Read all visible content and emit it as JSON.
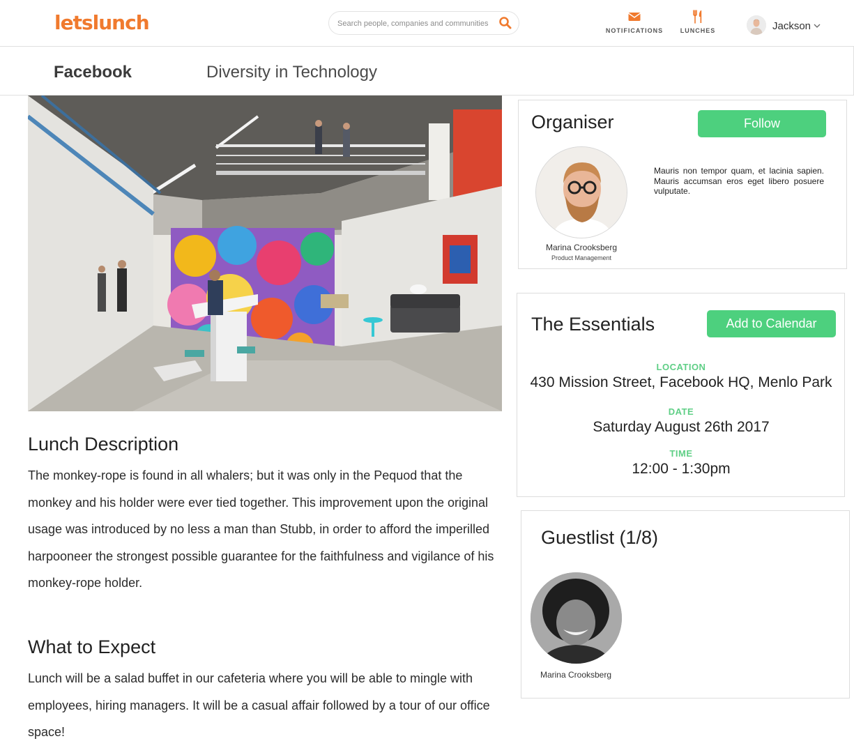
{
  "header": {
    "logo": "letslunch",
    "search_placeholder": "Search people, companies and communities",
    "nav": {
      "notifications_label": "NOTIFICATIONS",
      "lunches_label": "LUNCHES"
    },
    "user_name": "Jackson"
  },
  "subheader": {
    "company": "Facebook",
    "event_title": "Diversity in Technology"
  },
  "description": {
    "title": "Lunch Description",
    "body": "The monkey-rope is found in all whalers; but it was only in the Pequod that the monkey and his holder were ever tied together. This improvement upon the original usage was introduced by no less a man than Stubb, in order to afford the imperilled harpooneer the strongest possible guarantee for the faithfulness and vigilance of his monkey-rope holder."
  },
  "expect": {
    "title": "What to Expect",
    "body": "Lunch will be a salad buffet in our cafeteria where you will be able to mingle with employees, hiring managers. It will be a casual affair followed by a tour of our office space!"
  },
  "organiser": {
    "title": "Organiser",
    "follow_label": "Follow",
    "name": "Marina Crooksberg",
    "role": "Product Management",
    "bio": "Mauris non tempor quam, et lacinia sapien. Mauris accumsan eros eget libero posuere vulputate."
  },
  "essentials": {
    "title": "The Essentials",
    "calendar_label": "Add to Calendar",
    "location_label": "LOCATION",
    "location": "430 Mission Street, Facebook HQ, Menlo Park",
    "date_label": "DATE",
    "date": "Saturday August 26th 2017",
    "time_label": "TIME",
    "time": "12:00 - 1:30pm"
  },
  "guestlist": {
    "title": "Guestlist (1/8)",
    "guests": [
      {
        "name": "Marina Crooksberg"
      }
    ]
  },
  "colors": {
    "brand_orange": "#f07a2e",
    "accent_green": "#4dd07e",
    "label_green": "#5fcf86"
  },
  "icons": {
    "search": "search-icon",
    "notifications": "envelope-icon",
    "lunches": "fork-knife-icon",
    "user_menu": "chevron-down-icon"
  }
}
